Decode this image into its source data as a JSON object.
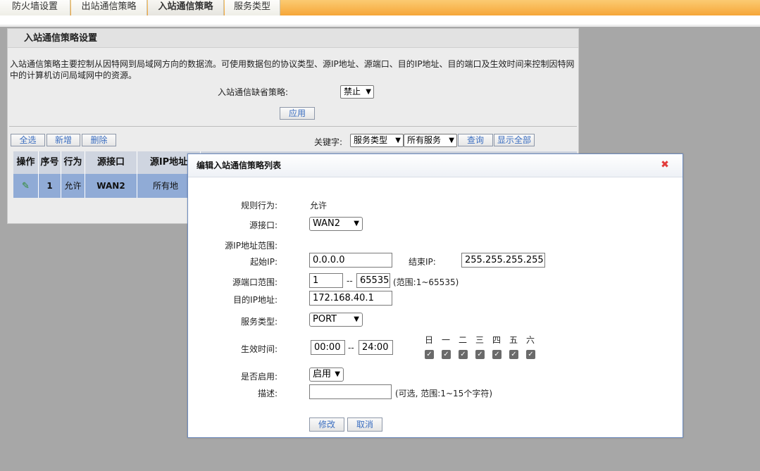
{
  "tabs": [
    {
      "label": "防火墙设置",
      "active": false
    },
    {
      "label": "出站通信策略",
      "active": false
    },
    {
      "label": "入站通信策略",
      "active": true
    },
    {
      "label": "服务类型",
      "active": false
    }
  ],
  "panel": {
    "title": "入站通信策略设置",
    "description": "入站通信策略主要控制从因特网到局域网方向的数据流。可使用数据包的协议类型、源IP地址、源端口、目的IP地址、目的端口及生效时间来控制因特网中的计算机访问局域网中的资源。",
    "default_policy_label": "入站通信缺省策略:",
    "default_policy_value": "禁止",
    "apply_label": "应用",
    "toolbar": {
      "select_all": "全选",
      "add": "新增",
      "delete": "删除",
      "keyword_label": "关键字:",
      "keyword_type": "服务类型",
      "keyword_value": "所有服务",
      "search": "查询",
      "show_all": "显示全部"
    },
    "table": {
      "headers": [
        "操作",
        "序号",
        "行为",
        "源接口",
        "源IP地址"
      ],
      "rows": [
        {
          "seq": "1",
          "action": "允许",
          "iface": "WAN2",
          "src_ip": "所有地"
        }
      ]
    }
  },
  "dialog": {
    "title": "编辑入站通信策略列表",
    "rule_action_label": "规则行为:",
    "rule_action_value": "允许",
    "src_iface_label": "源接口:",
    "src_iface_value": "WAN2",
    "src_ip_range_label": "源IP地址范围:",
    "start_ip_label": "起始IP:",
    "start_ip_value": "0.0.0.0",
    "end_ip_label": "结束IP:",
    "end_ip_value": "255.255.255.255",
    "src_port_label": "源端口范围:",
    "src_port_start": "1",
    "src_port_sep": "--",
    "src_port_end": "65535",
    "src_port_hint": "(范围:1~65535)",
    "dst_ip_label": "目的IP地址:",
    "dst_ip_value": "172.168.40.1",
    "service_label": "服务类型:",
    "service_value": "PORT",
    "time_label": "生效时间:",
    "time_start": "00:00",
    "time_sep": "--",
    "time_end": "24:00",
    "days": [
      "日",
      "一",
      "二",
      "三",
      "四",
      "五",
      "六"
    ],
    "days_checked": [
      true,
      true,
      true,
      true,
      true,
      true,
      true
    ],
    "enable_label": "是否启用:",
    "enable_value": "启用",
    "desc_label": "描述:",
    "desc_value": "",
    "desc_hint": "(可选, 范围:1~15个字符)",
    "modify": "修改",
    "cancel": "取消"
  }
}
